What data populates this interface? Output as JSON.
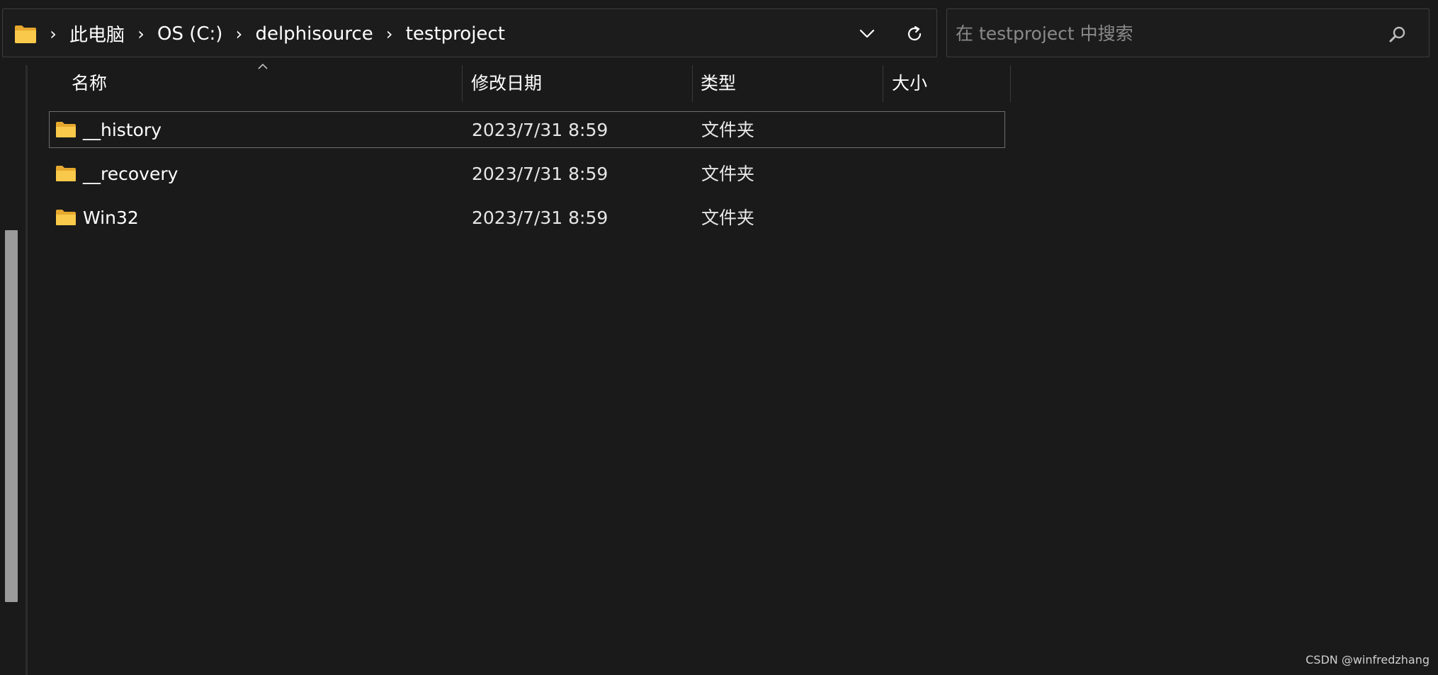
{
  "address_bar": {
    "icon": "folder-icon",
    "breadcrumbs": [
      {
        "label": "此电脑"
      },
      {
        "label": "OS (C:)"
      },
      {
        "label": "delphisource"
      },
      {
        "label": "testproject"
      }
    ],
    "dropdown_icon": "chevron-down-icon",
    "refresh_icon": "refresh-icon"
  },
  "search": {
    "placeholder": "在 testproject 中搜索",
    "icon": "search-icon"
  },
  "columns": {
    "name": "名称",
    "modified": "修改日期",
    "type": "类型",
    "size": "大小"
  },
  "files": [
    {
      "name": "__history",
      "modified": "2023/7/31 8:59",
      "type": "文件夹",
      "size": "",
      "selected": true
    },
    {
      "name": "__recovery",
      "modified": "2023/7/31 8:59",
      "type": "文件夹",
      "size": "",
      "selected": false
    },
    {
      "name": "Win32",
      "modified": "2023/7/31 8:59",
      "type": "文件夹",
      "size": "",
      "selected": false
    }
  ],
  "colors": {
    "background": "#1a1a1a",
    "folder_yellow": "#f8c94a",
    "selection_border": "#6e6e6e"
  },
  "watermark": "CSDN @winfredzhang"
}
